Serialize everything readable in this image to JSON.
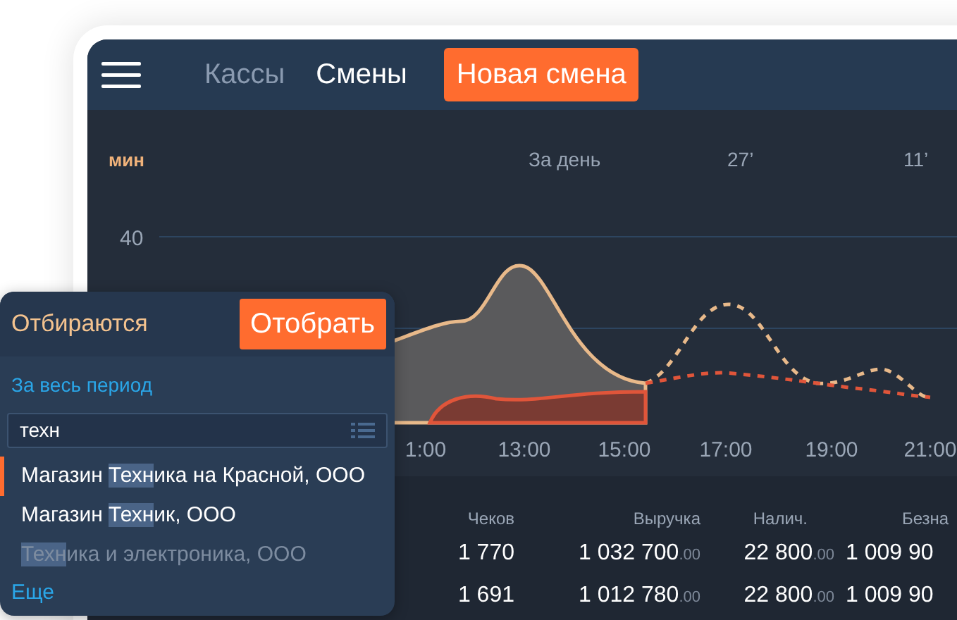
{
  "header": {
    "tabs": [
      {
        "label": "Кассы",
        "selected": false
      },
      {
        "label": "Смены",
        "selected": true
      }
    ],
    "new_button": "Новая смена"
  },
  "chart": {
    "unit": "мин",
    "summary": [
      {
        "label": "За день"
      },
      {
        "label": "27’"
      },
      {
        "label": "11’"
      }
    ],
    "y_tick": "40",
    "x_labels": [
      "1:00",
      "13:00",
      "15:00",
      "17:00",
      "19:00",
      "21:00"
    ]
  },
  "table": {
    "columns": [
      "Чеков",
      "Выручка",
      "Налич.",
      "Безна"
    ],
    "rows": [
      {
        "checks": "1 770",
        "revenue": "1 032 700",
        "revenue_cents": ".00",
        "cash": "22 800",
        "cash_cents": ".00",
        "cashless": "1 009 90"
      },
      {
        "checks": "1 691",
        "revenue": "1 012 780",
        "revenue_cents": ".00",
        "cash": "22 800",
        "cash_cents": ".00",
        "cashless": "1 009 90"
      }
    ]
  },
  "filter_popup": {
    "title": "Отбираются",
    "apply_button": "Отобрать",
    "period_link": "За весь период",
    "search": {
      "value": "техн"
    },
    "items": [
      {
        "before": "Магазин ",
        "match": "Техн",
        "after": "ика на Красной, ООО",
        "selected": true,
        "disabled": false
      },
      {
        "before": "Магазин ",
        "match": "Техн",
        "after": "ик, ООО",
        "selected": false,
        "disabled": false
      },
      {
        "match": "Техн",
        "after": "ика и электроника, ООО",
        "selected": false,
        "disabled": true
      }
    ],
    "more_link": "Еще"
  }
}
